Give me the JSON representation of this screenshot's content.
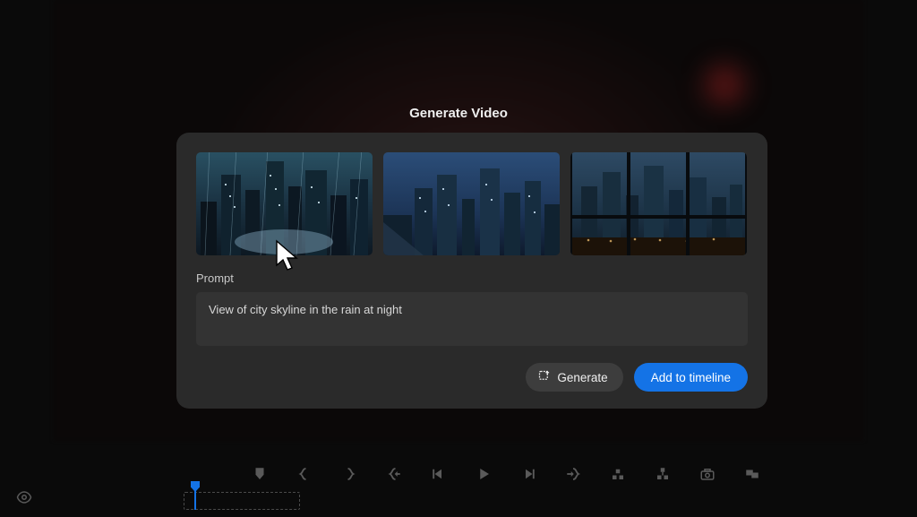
{
  "modal": {
    "title": "Generate Video",
    "prompt_label": "Prompt",
    "prompt_value": "View of city skyline in the rain at night",
    "generate_label": "Generate",
    "add_label": "Add to timeline"
  },
  "thumbnails": [
    {
      "name": "city-rain-night-closeup"
    },
    {
      "name": "city-skyline-blue-night"
    },
    {
      "name": "city-skyline-window-view"
    }
  ],
  "toolbar_icons": [
    "marker",
    "brace-open",
    "brace-close",
    "ripple-in",
    "step-back",
    "play",
    "step-forward",
    "ripple-out",
    "lift",
    "extract",
    "snapshot",
    "swap"
  ]
}
